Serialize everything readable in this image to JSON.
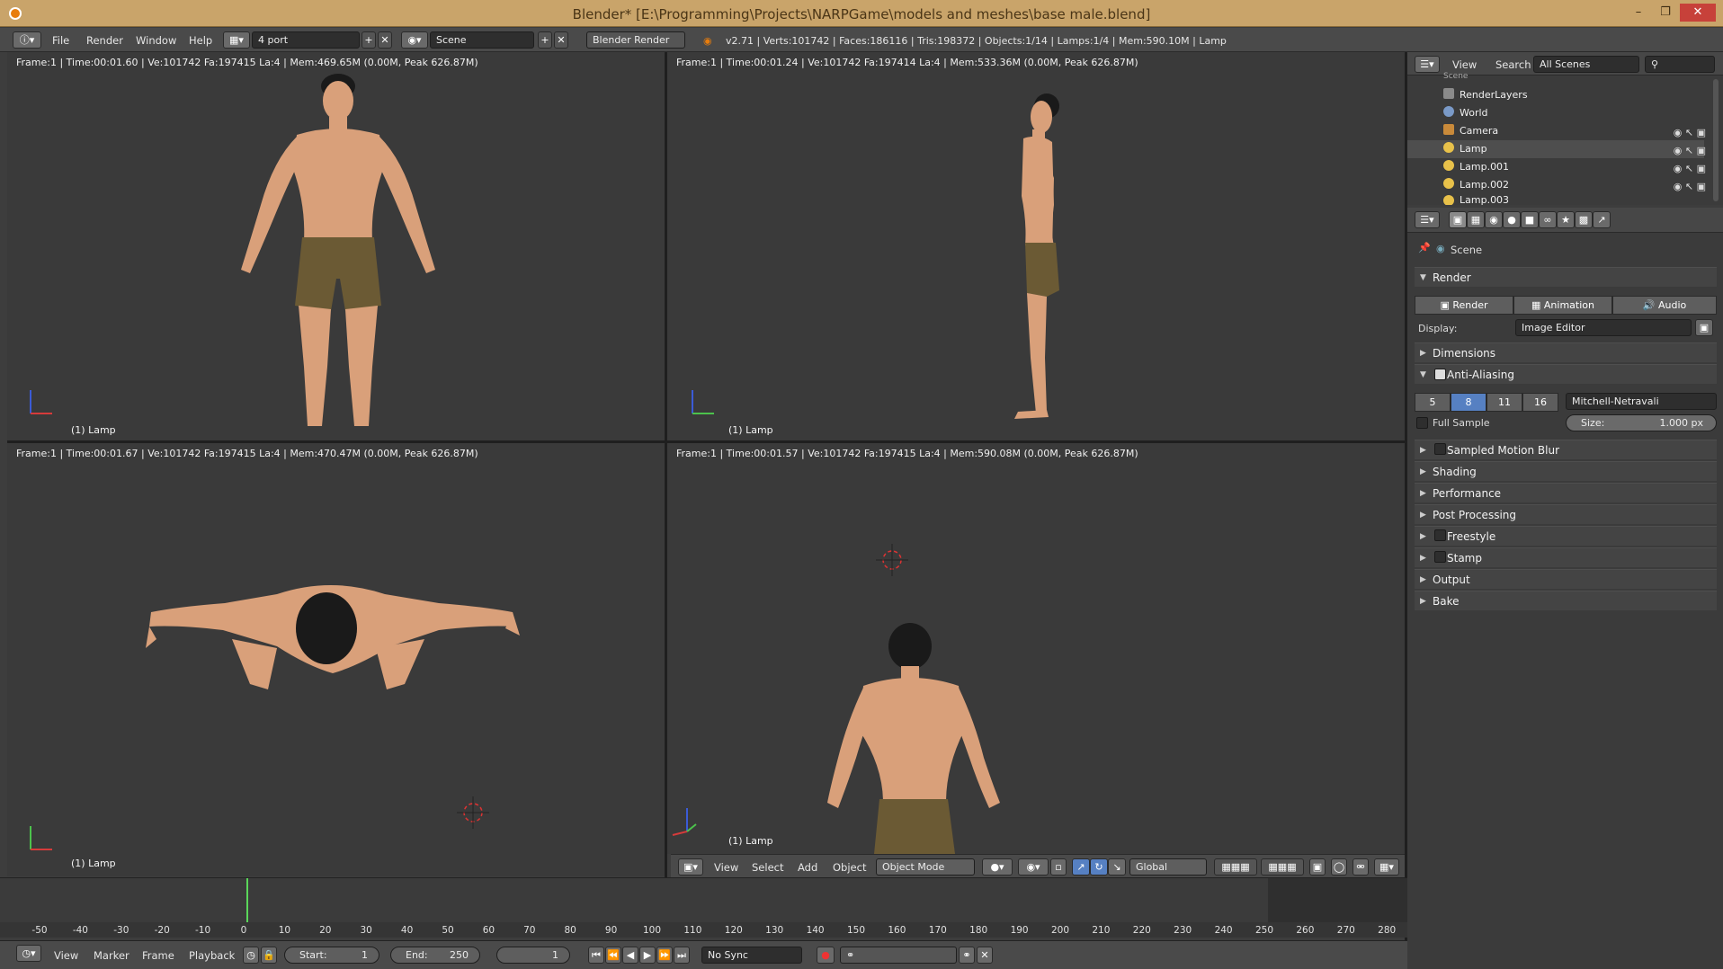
{
  "window": {
    "title": "Blender* [E:\\Programming\\Projects\\NARPGame\\models and meshes\\base male.blend]",
    "minimize": "–",
    "maximize": "❐",
    "close": "✕"
  },
  "menubar": {
    "file": "File",
    "render": "Render",
    "window": "Window",
    "help": "Help"
  },
  "screen_layout": "4 port",
  "scene": "Scene",
  "render_engine": "Blender Render",
  "stats": "v2.71 | Verts:101742 | Faces:186116 | Tris:198372 | Objects:1/14 | Lamps:1/4 | Mem:590.10M | Lamp",
  "viewports": {
    "top_left": {
      "header": "Frame:1 | Time:00:01.60 | Ve:101742 Fa:197415 La:4 | Mem:469.65M (0.00M, Peak 626.87M)",
      "object": "(1) Lamp"
    },
    "top_right": {
      "header": "Frame:1 | Time:00:01.24 | Ve:101742 Fa:197414 La:4 | Mem:533.36M (0.00M, Peak 626.87M)",
      "object": "(1) Lamp"
    },
    "bottom_left": {
      "header": "Frame:1 | Time:00:01.67 | Ve:101742 Fa:197415 La:4 | Mem:470.47M (0.00M, Peak 626.87M)",
      "object": "(1) Lamp"
    },
    "bottom_right": {
      "header": "Frame:1 | Time:00:01.57 | Ve:101742 Fa:197415 La:4 | Mem:590.08M (0.00M, Peak 626.87M)",
      "object": "(1) Lamp"
    }
  },
  "viewport_header": {
    "view": "View",
    "select": "Select",
    "add": "Add",
    "object": "Object",
    "mode": "Object Mode",
    "orientation": "Global"
  },
  "outliner": {
    "view": "View",
    "search": "Search",
    "filter": "All Scenes",
    "scene_label": "Scene",
    "items": [
      "RenderLayers",
      "World",
      "Camera",
      "Lamp",
      "Lamp.001",
      "Lamp.002",
      "Lamp.003"
    ]
  },
  "properties": {
    "context": "Scene",
    "render_panel": "Render",
    "render_btn": "Render",
    "animation_btn": "Animation",
    "audio_btn": "Audio",
    "display_label": "Display:",
    "display_value": "Image Editor",
    "dimensions": "Dimensions",
    "anti_aliasing": "Anti-Aliasing",
    "aa_samples": [
      "5",
      "8",
      "11",
      "16"
    ],
    "aa_filter": "Mitchell-Netravali",
    "full_sample": "Full Sample",
    "size_label": "Size:",
    "size_value": "1.000 px",
    "panels": [
      "Sampled Motion Blur",
      "Shading",
      "Performance",
      "Post Processing",
      "Freestyle",
      "Stamp",
      "Output",
      "Bake"
    ]
  },
  "timeline": {
    "ruler": [
      "-50",
      "-40",
      "-30",
      "-20",
      "-10",
      "0",
      "10",
      "20",
      "30",
      "40",
      "50",
      "60",
      "70",
      "80",
      "90",
      "100",
      "110",
      "120",
      "130",
      "140",
      "150",
      "160",
      "170",
      "180",
      "190",
      "200",
      "210",
      "220",
      "230",
      "240",
      "250",
      "260",
      "270",
      "280"
    ],
    "current_frame": 1,
    "view": "View",
    "marker": "Marker",
    "frame": "Frame",
    "playback": "Playback",
    "start_label": "Start:",
    "start_value": "1",
    "end_label": "End:",
    "end_value": "250",
    "frame_value": "1",
    "sync": "No Sync"
  }
}
